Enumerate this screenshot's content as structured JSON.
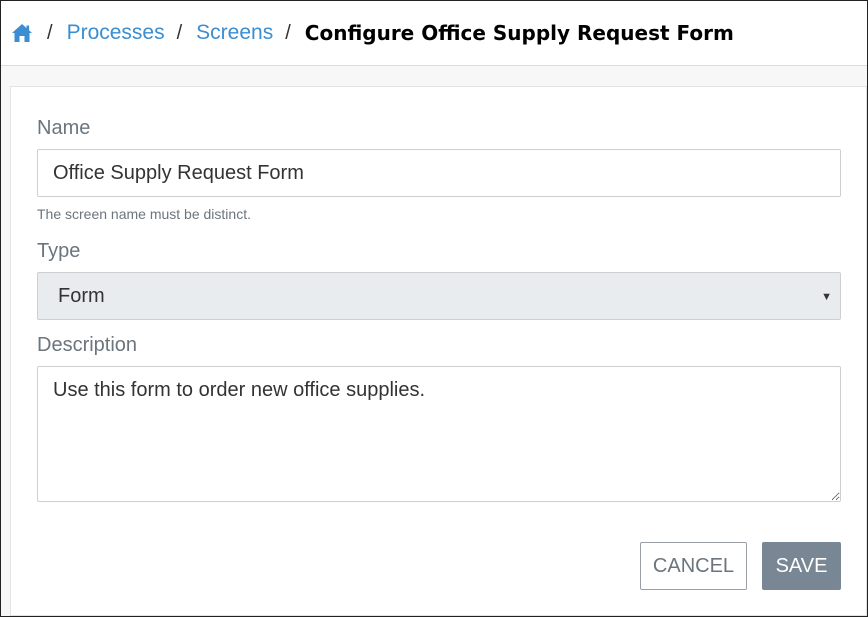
{
  "breadcrumb": {
    "home_icon": "home-icon",
    "items": [
      "Processes",
      "Screens"
    ],
    "separator": "/",
    "current": "Configure Office Supply Request Form"
  },
  "form": {
    "name_label": "Name",
    "name_value": "Office Supply Request Form",
    "name_help": "The screen name must be distinct.",
    "type_label": "Type",
    "type_value": "Form",
    "description_label": "Description",
    "description_value": "Use this form to order new office supplies."
  },
  "actions": {
    "cancel_label": "CANCEL",
    "save_label": "SAVE"
  },
  "colors": {
    "link": "#3a8ed1",
    "save_bg": "#788793",
    "select_bg": "#e9ecef"
  }
}
